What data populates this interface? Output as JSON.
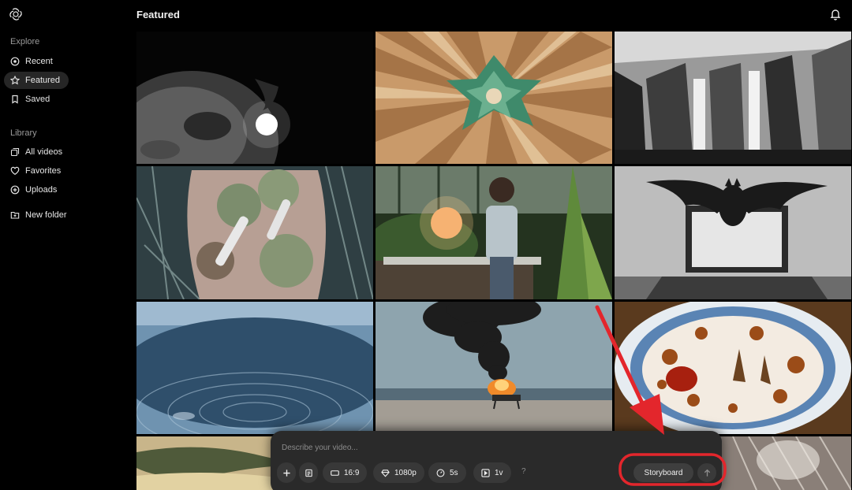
{
  "app": {
    "logo_icon": "openai-logo-icon",
    "accent": "#e3262c"
  },
  "header": {
    "title": "Featured",
    "notification_icon": "bell-icon"
  },
  "sidebar": {
    "explore_label": "Explore",
    "explore_items": [
      {
        "label": "Recent",
        "icon": "clock-icon"
      },
      {
        "label": "Featured",
        "icon": "star-icon",
        "active": true
      },
      {
        "label": "Saved",
        "icon": "bookmark-icon"
      }
    ],
    "library_label": "Library",
    "library_items": [
      {
        "label": "All videos",
        "icon": "stack-icon"
      },
      {
        "label": "Favorites",
        "icon": "heart-icon"
      },
      {
        "label": "Uploads",
        "icon": "plus-circle-icon"
      }
    ],
    "new_folder_label": "New folder"
  },
  "grid": {
    "tiles": [
      "moon",
      "origami-star",
      "concrete-columns",
      "sea-urchin",
      "greenhouse-child",
      "bat-laptop",
      "water-ripple",
      "burning-cart-beach",
      "coffee-foam",
      "sand-dunes",
      "fur-closeup"
    ]
  },
  "composer": {
    "placeholder": "Describe your video...",
    "aspect_ratio": "16:9",
    "resolution": "1080p",
    "duration": "5s",
    "variations": "1v",
    "help": "?",
    "storyboard_label": "Storyboard"
  }
}
